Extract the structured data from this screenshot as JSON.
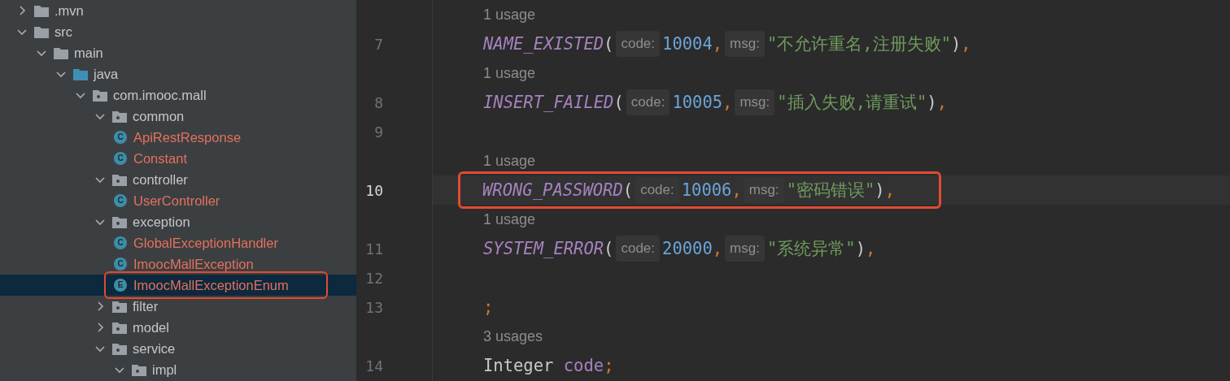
{
  "project_tree": [
    {
      "name": ".mvn",
      "kind": "folder",
      "expanded": false,
      "selected": false,
      "highlighted": false
    },
    {
      "name": "src",
      "kind": "folder",
      "expanded": true,
      "selected": false,
      "highlighted": false,
      "children": [
        {
          "name": "main",
          "kind": "folder",
          "expanded": true,
          "selected": false,
          "highlighted": false,
          "children": [
            {
              "name": "java",
              "kind": "source_root",
              "expanded": true,
              "selected": false,
              "highlighted": false,
              "children": [
                {
                  "name": "com.imooc.mall",
                  "kind": "package",
                  "expanded": true,
                  "selected": false,
                  "highlighted": false,
                  "children": [
                    {
                      "name": "common",
                      "kind": "package",
                      "expanded": true,
                      "selected": false,
                      "highlighted": false,
                      "children": [
                        {
                          "name": "ApiRestResponse",
                          "kind": "class",
                          "badge": "C",
                          "selected": false,
                          "highlighted": false
                        },
                        {
                          "name": "Constant",
                          "kind": "class",
                          "badge": "C",
                          "selected": false,
                          "highlighted": false
                        }
                      ]
                    },
                    {
                      "name": "controller",
                      "kind": "package",
                      "expanded": true,
                      "selected": false,
                      "highlighted": false,
                      "children": [
                        {
                          "name": "UserController",
                          "kind": "class",
                          "badge": "C",
                          "selected": false,
                          "highlighted": false
                        }
                      ]
                    },
                    {
                      "name": "exception",
                      "kind": "package",
                      "expanded": true,
                      "selected": false,
                      "highlighted": false,
                      "children": [
                        {
                          "name": "GlobalExceptionHandler",
                          "kind": "class",
                          "badge": "C",
                          "selected": false,
                          "highlighted": false
                        },
                        {
                          "name": "ImoocMallException",
                          "kind": "class",
                          "badge": "C",
                          "selected": false,
                          "highlighted": false
                        },
                        {
                          "name": "ImoocMallExceptionEnum",
                          "kind": "enum",
                          "badge": "E",
                          "selected": true,
                          "highlighted": true
                        }
                      ]
                    },
                    {
                      "name": "filter",
                      "kind": "package",
                      "expanded": false,
                      "selected": false,
                      "highlighted": false
                    },
                    {
                      "name": "model",
                      "kind": "package",
                      "expanded": false,
                      "selected": false,
                      "highlighted": false
                    },
                    {
                      "name": "service",
                      "kind": "package",
                      "expanded": true,
                      "selected": false,
                      "highlighted": false,
                      "children": [
                        {
                          "name": "impl",
                          "kind": "package",
                          "expanded": true,
                          "selected": false,
                          "highlighted": false
                        }
                      ]
                    }
                  ]
                }
              ]
            }
          ]
        }
      ]
    }
  ],
  "editor_lines": [
    {
      "kind": "usage",
      "text": "1 usage"
    },
    {
      "kind": "code",
      "number": "7",
      "current": false,
      "highlighted": false,
      "tokens": [
        {
          "kind": "constant",
          "text": "NAME_EXISTED"
        },
        {
          "kind": "punct",
          "text": "("
        },
        {
          "kind": "hint",
          "text": "code:"
        },
        {
          "kind": "number",
          "text": "10004"
        },
        {
          "kind": "comma",
          "text": ","
        },
        {
          "kind": "hint",
          "text": "msg:"
        },
        {
          "kind": "string",
          "text": "\"不允许重名,注册失败\""
        },
        {
          "kind": "punct",
          "text": ")"
        },
        {
          "kind": "comma",
          "text": ","
        }
      ]
    },
    {
      "kind": "usage",
      "text": "1 usage"
    },
    {
      "kind": "code",
      "number": "8",
      "current": false,
      "highlighted": false,
      "tokens": [
        {
          "kind": "constant",
          "text": "INSERT_FAILED"
        },
        {
          "kind": "punct",
          "text": "("
        },
        {
          "kind": "hint",
          "text": "code:"
        },
        {
          "kind": "number",
          "text": "10005"
        },
        {
          "kind": "comma",
          "text": ","
        },
        {
          "kind": "hint",
          "text": "msg:"
        },
        {
          "kind": "string",
          "text": "\"插入失败,请重试\""
        },
        {
          "kind": "punct",
          "text": ")"
        },
        {
          "kind": "comma",
          "text": ","
        }
      ]
    },
    {
      "kind": "code",
      "number": "9",
      "current": false,
      "highlighted": false
    },
    {
      "kind": "usage",
      "text": "1 usage"
    },
    {
      "kind": "code",
      "number": "10",
      "current": true,
      "highlighted": true,
      "tokens": [
        {
          "kind": "constant",
          "text": "WRONG_PASSWORD"
        },
        {
          "kind": "punct",
          "text": "("
        },
        {
          "kind": "hint",
          "text": "code:"
        },
        {
          "kind": "number",
          "text": "10006"
        },
        {
          "kind": "comma",
          "text": ","
        },
        {
          "kind": "hint",
          "text": "msg:"
        },
        {
          "kind": "string",
          "text": "\"密码错误\""
        },
        {
          "kind": "punct",
          "text": ")"
        },
        {
          "kind": "comma",
          "text": ","
        }
      ]
    },
    {
      "kind": "usage",
      "text": "1 usage"
    },
    {
      "kind": "code",
      "number": "11",
      "current": false,
      "highlighted": false,
      "tokens": [
        {
          "kind": "constant",
          "text": "SYSTEM_ERROR"
        },
        {
          "kind": "punct",
          "text": "("
        },
        {
          "kind": "hint",
          "text": "code:"
        },
        {
          "kind": "number",
          "text": "20000"
        },
        {
          "kind": "comma",
          "text": ","
        },
        {
          "kind": "hint",
          "text": "msg:"
        },
        {
          "kind": "string",
          "text": "\"系统异常\""
        },
        {
          "kind": "punct",
          "text": ")"
        },
        {
          "kind": "comma",
          "text": ","
        }
      ]
    },
    {
      "kind": "code",
      "number": "12",
      "current": false,
      "highlighted": false
    },
    {
      "kind": "code",
      "number": "13",
      "current": false,
      "highlighted": false,
      "tokens": [
        {
          "kind": "comma",
          "text": ";"
        }
      ]
    },
    {
      "kind": "usage",
      "text": "3 usages"
    },
    {
      "kind": "code",
      "number": "14",
      "current": false,
      "highlighted": false,
      "tokens": [
        {
          "kind": "plain",
          "text": "Integer "
        },
        {
          "kind": "field",
          "text": "code"
        },
        {
          "kind": "comma",
          "text": ";"
        }
      ]
    }
  ]
}
